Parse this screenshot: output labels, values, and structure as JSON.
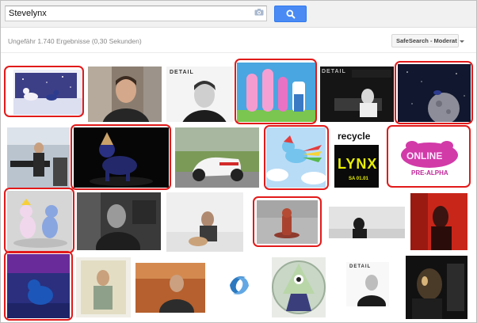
{
  "search": {
    "query": "Stevelynx",
    "button_icon": "search-icon",
    "camera_icon": "camera-icon"
  },
  "results": {
    "stats": "Ungefähr 1.740 Ergebnisse (0,30 Sekunden)",
    "safesearch_label": "SafeSearch - Moderat"
  },
  "tiles_text": {
    "detail_1": "DETAIL",
    "detail_2": "DETAIL",
    "detail_3": "DETAIL",
    "recycle": "recycle",
    "lynx": "LYNX",
    "lynx_date": "SA 01.01",
    "online": "ONLINE",
    "pre_alpha": "PRE-ALPHA"
  },
  "colors": {
    "highlight": "#e21a1a",
    "search_button": "#4a8af4"
  }
}
